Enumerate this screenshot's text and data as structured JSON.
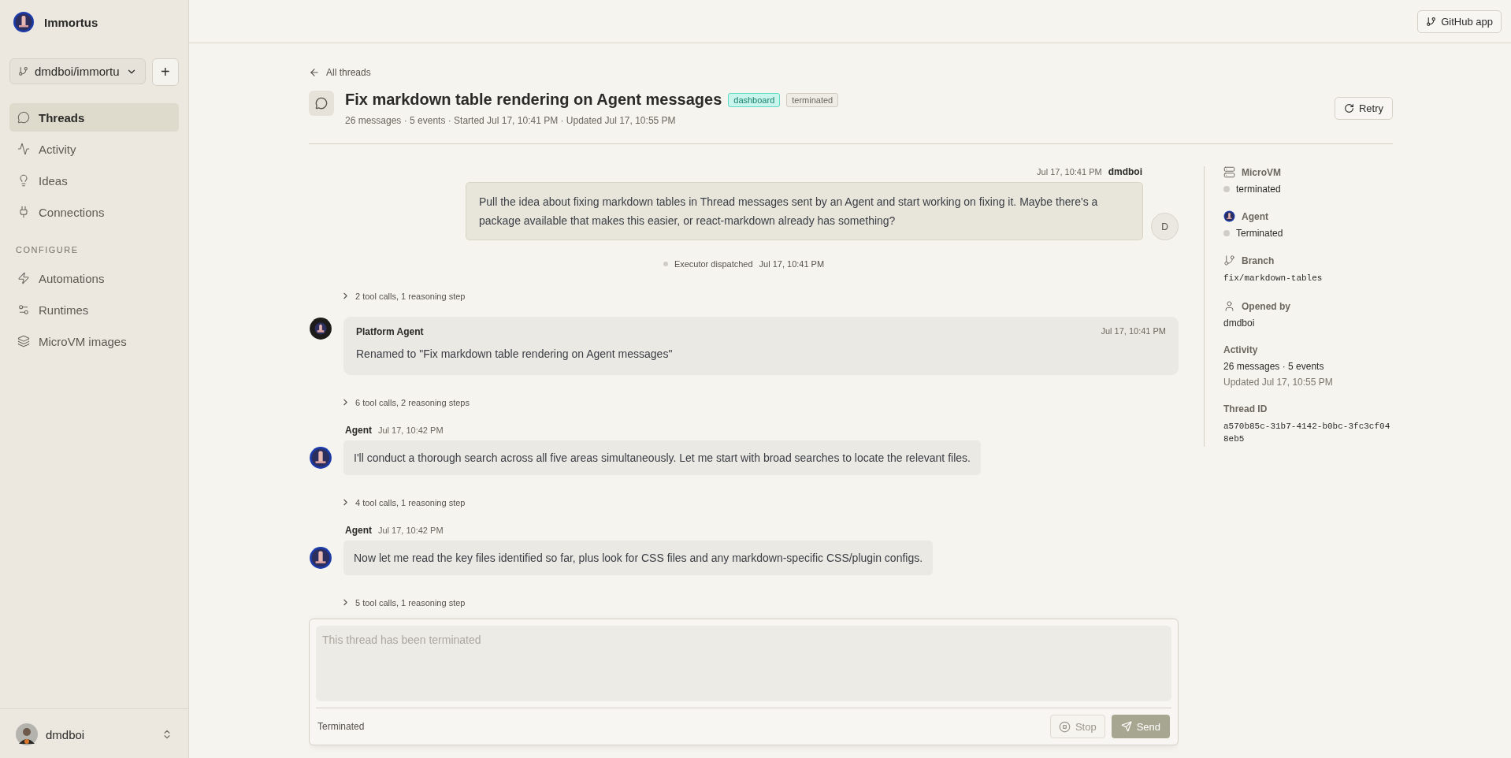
{
  "sidebar": {
    "app_name": "Immortus",
    "repo": "dmdboi/immortu",
    "add_button": "+",
    "items": [
      {
        "label": "Threads",
        "selected": true
      },
      {
        "label": "Activity",
        "selected": false
      },
      {
        "label": "Ideas",
        "selected": false
      },
      {
        "label": "Connections",
        "selected": false
      }
    ],
    "section": "CONFIGURE",
    "config_items": [
      {
        "label": "Automations",
        "selected": false
      },
      {
        "label": "Runtimes",
        "selected": false
      },
      {
        "label": "MicroVM images",
        "selected": false
      }
    ],
    "user": "dmdboi"
  },
  "topbar": {
    "github_button": "GitHub app"
  },
  "thread": {
    "back": "All threads",
    "title": "Fix markdown table rendering on Agent messages",
    "tags": [
      {
        "label": "dashboard",
        "kind": "highlight"
      },
      {
        "label": "terminated",
        "kind": "plain"
      }
    ],
    "meta": "26 messages · 5 events · Started Jul 17, 10:41 PM · Updated Jul 17, 10:55 PM",
    "retry": "Retry"
  },
  "messages": [
    {
      "kind": "user",
      "time": "Jul 17, 10:41 PM",
      "author": "dmdboi",
      "avatar": "D",
      "text": "Pull the idea about fixing markdown tables in Thread messages sent by an Agent and start working on fixing it. Maybe there's a package available that makes this easier, or react-markdown already has something?"
    },
    {
      "kind": "event",
      "text": "Executor dispatched",
      "time": "Jul 17, 10:41 PM"
    },
    {
      "kind": "tools",
      "text": "2 tool calls, 1 reasoning step"
    },
    {
      "kind": "system",
      "author": "Platform Agent",
      "time": "Jul 17, 10:41 PM",
      "text": "Renamed to \"Fix markdown table rendering on Agent messages\""
    },
    {
      "kind": "tools",
      "text": "6 tool calls, 2 reasoning steps"
    },
    {
      "kind": "agent",
      "author": "Agent",
      "time": "Jul 17, 10:42 PM",
      "text": "I'll conduct a thorough search across all five areas simultaneously. Let me start with broad searches to locate the relevant files."
    },
    {
      "kind": "tools",
      "text": "4 tool calls, 1 reasoning step"
    },
    {
      "kind": "agent",
      "author": "Agent",
      "time": "Jul 17, 10:42 PM",
      "text": "Now let me read the key files identified so far, plus look for CSS files and any markdown-specific CSS/plugin configs."
    },
    {
      "kind": "tools",
      "text": "5 tool calls, 1 reasoning step"
    }
  ],
  "details": [
    {
      "kind": "status",
      "label": "MicroVM",
      "value": "terminated"
    },
    {
      "kind": "status",
      "label": "Agent",
      "value": "Terminated"
    },
    {
      "kind": "mono",
      "label": "Branch",
      "value": "fix/markdown-tables"
    },
    {
      "kind": "text",
      "label": "Opened by",
      "value": "dmdboi"
    },
    {
      "kind": "activity",
      "label": "Activity",
      "value": "26 messages · 5 events",
      "sub": "Updated Jul 17, 10:55 PM"
    },
    {
      "kind": "mono",
      "label": "Thread ID",
      "value": "a570b85c-31b7-4142-b0bc-3fc3cf048eb5"
    }
  ],
  "composer": {
    "placeholder": "This thread has been terminated",
    "status": "Terminated",
    "stop": "Stop",
    "send": "Send"
  }
}
